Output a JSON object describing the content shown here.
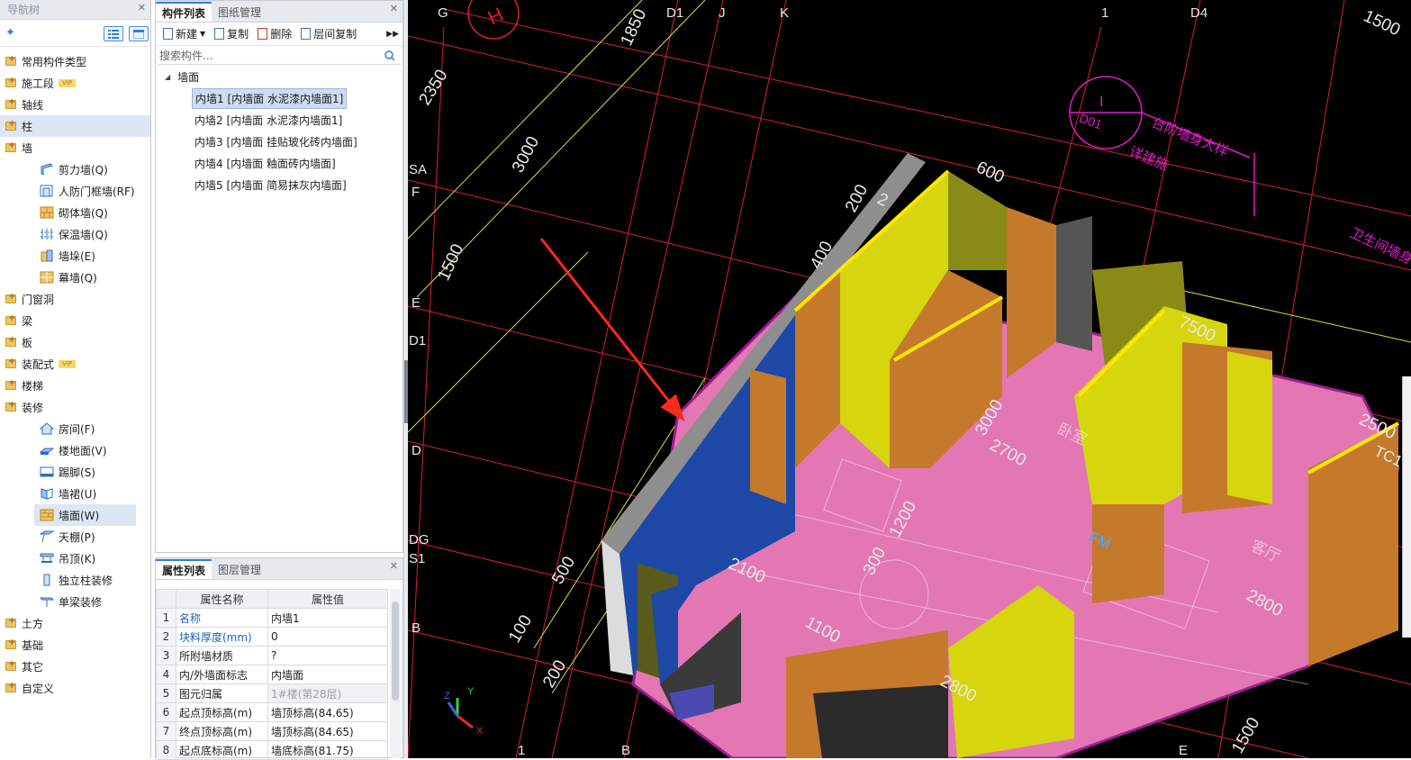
{
  "nav": {
    "title": "导航树",
    "items": [
      {
        "label": "常用构件类型"
      },
      {
        "label": "施工段",
        "badge": "VIP"
      },
      {
        "label": "轴线"
      },
      {
        "label": "柱"
      },
      {
        "label": "墙"
      },
      {
        "label": "剪力墙(Q)"
      },
      {
        "label": "人防门框墙(RF)"
      },
      {
        "label": "砌体墙(Q)"
      },
      {
        "label": "保温墙(Q)"
      },
      {
        "label": "墙垛(E)"
      },
      {
        "label": "幕墙(Q)"
      },
      {
        "label": "门窗洞"
      },
      {
        "label": "梁"
      },
      {
        "label": "板"
      },
      {
        "label": "装配式",
        "badge": "VIP"
      },
      {
        "label": "楼梯"
      },
      {
        "label": "装修"
      },
      {
        "label": "房间(F)"
      },
      {
        "label": "楼地面(V)"
      },
      {
        "label": "踢脚(S)"
      },
      {
        "label": "墙裙(U)"
      },
      {
        "label": "墙面(W)"
      },
      {
        "label": "天棚(P)"
      },
      {
        "label": "吊顶(K)"
      },
      {
        "label": "独立柱装修"
      },
      {
        "label": "单梁装修"
      },
      {
        "label": "土方"
      },
      {
        "label": "基础"
      },
      {
        "label": "其它"
      },
      {
        "label": "自定义"
      }
    ]
  },
  "components": {
    "tabs": [
      "构件列表",
      "图纸管理"
    ],
    "actions": [
      "新建",
      "复制",
      "删除",
      "层间复制"
    ],
    "search_placeholder": "搜索构件...",
    "root": "墙面",
    "items": [
      "内墙1 [内墙面 水泥漆内墙面1]",
      "内墙2 [内墙面 水泥漆内墙面1]",
      "内墙3 [内墙面 挂贴玻化砖内墙面]",
      "内墙4 [内墙面 釉面砖内墙面]",
      "内墙5 [内墙面 简易抹灰内墙面]"
    ]
  },
  "properties": {
    "tabs": [
      "属性列表",
      "图层管理"
    ],
    "headers": [
      "属性名称",
      "属性值"
    ],
    "rows": [
      {
        "idx": "1",
        "name": "名称",
        "value": "内墙1"
      },
      {
        "idx": "2",
        "name": "块料厚度(mm)",
        "value": "0"
      },
      {
        "idx": "3",
        "name": "所附墙材质",
        "value": "?"
      },
      {
        "idx": "4",
        "name": "内/外墙面标志",
        "value": "内墙面"
      },
      {
        "idx": "5",
        "name": "图元归属",
        "value": "1#楼(第28层)"
      },
      {
        "idx": "6",
        "name": "起点顶标高(m)",
        "value": "墙顶标高(84.65)"
      },
      {
        "idx": "7",
        "name": "终点顶标高(m)",
        "value": "墙顶标高(84.65)"
      },
      {
        "idx": "8",
        "name": "起点底标高(m)",
        "value": "墙底标高(81.75)"
      }
    ]
  },
  "viewport": {
    "grid_labels_top": [
      "G",
      "D1",
      "J",
      "K",
      "1",
      "D4"
    ],
    "grid_labels_left": [
      "SA",
      "F",
      "E",
      "D1",
      "D",
      "DG",
      "S1",
      "B"
    ],
    "grid_labels_bottom": [
      "1",
      "B",
      "E"
    ],
    "dimensions": [
      "2350",
      "1850",
      "3000",
      "1500",
      "1500",
      "200",
      "400",
      "600",
      "3000",
      "2700",
      "1200",
      "2100",
      "300",
      "1100",
      "2800",
      "2800",
      "500",
      "100",
      "200",
      "1500",
      "2500",
      "7500",
      "2"
    ],
    "annotations": [
      "H",
      "I",
      "D01",
      "台阶墙身大样",
      "详建施",
      "卫生间墙身大样",
      "TC1",
      "FM",
      "客厅",
      "卧室"
    ],
    "axis_labels": [
      "Y",
      "Z",
      "X"
    ],
    "colors": {
      "floor": "#e377b4",
      "wall_orange": "#c57a2b",
      "wall_yellow": "#d6d50e",
      "wall_blue": "#1d48a6",
      "grid_red": "#d8202a",
      "magenta": "#e21bc9",
      "arrow": "#ff2a1a"
    }
  }
}
